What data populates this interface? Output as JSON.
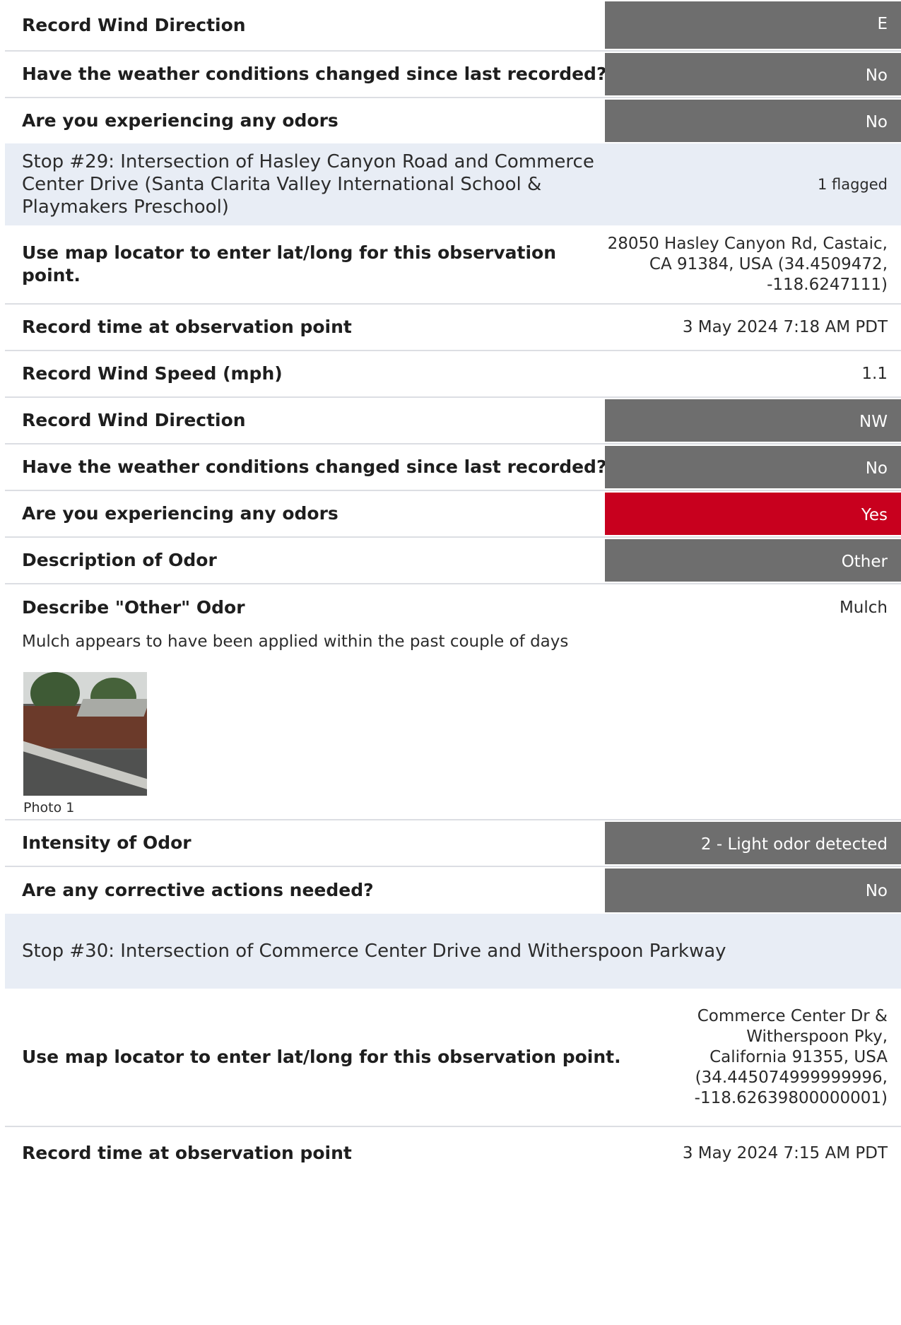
{
  "top_rows": [
    {
      "label": "Record Wind Direction",
      "value": "E"
    },
    {
      "label": "Have the weather conditions changed since last recorded?",
      "value": "No"
    },
    {
      "label": "Are you experiencing any odors",
      "value": "No"
    }
  ],
  "stop29": {
    "title": "Stop #29: Intersection of Hasley Canyon Road and Commerce Center Drive (Santa Clarita Valley International School & Playmakers Preschool)",
    "flag": "1 flagged",
    "location": {
      "label": "Use map locator to enter lat/long for this observation point.",
      "value": "28050 Hasley Canyon Rd, Castaic, CA 91384, USA (34.4509472, -118.6247111)"
    },
    "time": {
      "label": "Record time at observation point",
      "value": "3 May 2024 7:18 AM PDT"
    },
    "wind_speed": {
      "label": "Record Wind Speed (mph)",
      "value": "1.1"
    },
    "wind_direction": {
      "label": "Record Wind Direction",
      "value": "NW"
    },
    "weather_changed": {
      "label": "Have the weather conditions changed since last recorded?",
      "value": "No"
    },
    "odors": {
      "label": "Are you experiencing any odors",
      "value": "Yes",
      "flag_color": "#c8001e"
    },
    "odor_description": {
      "label": "Description of Odor",
      "value": "Other"
    },
    "other_odor": {
      "label": "Describe \"Other\" Odor",
      "value": "Mulch",
      "note": "Mulch appears to have been applied within the past couple of days",
      "photo_caption": "Photo 1"
    },
    "intensity": {
      "label": "Intensity of Odor",
      "value": "2 - Light odor detected"
    },
    "corrective": {
      "label": "Are any corrective actions needed?",
      "value": "No"
    }
  },
  "stop30": {
    "title": "Stop #30: Intersection of Commerce Center Drive and Witherspoon Parkway",
    "location": {
      "label": "Use map locator to enter lat/long for this observation point.",
      "value": "Commerce Center Dr & Witherspoon Pky, California 91355, USA (34.445074999999996, -118.62639800000001)"
    },
    "time": {
      "label": "Record time at observation point",
      "value": "3 May 2024 7:15 AM PDT"
    }
  },
  "colors": {
    "pill": "#6e6e6e",
    "flag": "#c8001e",
    "section_bg": "#e8edf5",
    "divider": "#dcdee3"
  }
}
